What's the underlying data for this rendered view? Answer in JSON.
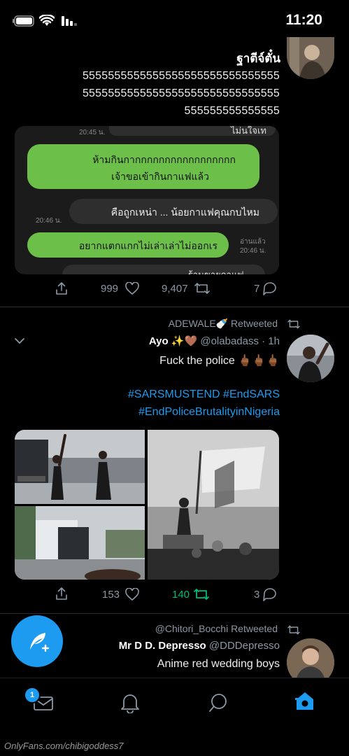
{
  "status_bar": {
    "time": "11:20"
  },
  "tweet1": {
    "name": "ฐาตีจ์ตั๋น",
    "body_lines": [
      "5555555555555555555555555555555",
      "5555555555555555555555555555555",
      "555555555555555"
    ],
    "chat": [
      {
        "text": "ไม่นใจเท",
        "time": "20:45 น.",
        "side": "dark"
      },
      {
        "text": "ห้ามกินกากกกกกกกกกกกกกกกกก",
        "time": "",
        "side": "green"
      },
      {
        "text": "เจ้าขอเข้ากินกาแฟแล้ว",
        "time": "",
        "side": "green"
      },
      {
        "text": "คือถูกเหน่า ... น้อยกาแฟคุณกบไหม",
        "time": "20:46 น.",
        "side": "dark"
      },
      {
        "text": "อยากแตกแกกไม่เล่าเล่าไม่ออกเร",
        "time": "20:46 น.",
        "side": "green",
        "read": "อ่านแล้ว"
      },
      {
        "text": "ร้านขายกาแฟ ...",
        "time": "",
        "side": "dark"
      }
    ],
    "replies": "7",
    "retweets": "9,407",
    "likes": "999"
  },
  "tweet2": {
    "retweet_label": "ADEWALE🍼 Retweeted",
    "name": "Ayo ✨🤎",
    "handle": "@olabadass · 1h",
    "text": "Fuck the police 🖕🏾🖕🏾🖕🏾",
    "hashtags_line1": "#SARSMUSTEND #EndSARS",
    "hashtags_line2": "#EndPoliceBrutalityinNigeria",
    "replies": "3",
    "retweets": "140",
    "likes": "153"
  },
  "tweet3": {
    "retweet_label": "@Chitori_Bocchi Retweeted",
    "name": "Mr D D. Depresso",
    "handle": "@DDDepresso",
    "text": "Anime red wedding boys"
  },
  "tab_bar": {
    "messages_badge": "1"
  },
  "watermark": "OnlyFans.com/chibigoddess7",
  "colors": {
    "accent": "#1d9bf0",
    "retweet_green": "#00ba7c",
    "chat_green": "#6cc04a",
    "bg": "#000000"
  }
}
